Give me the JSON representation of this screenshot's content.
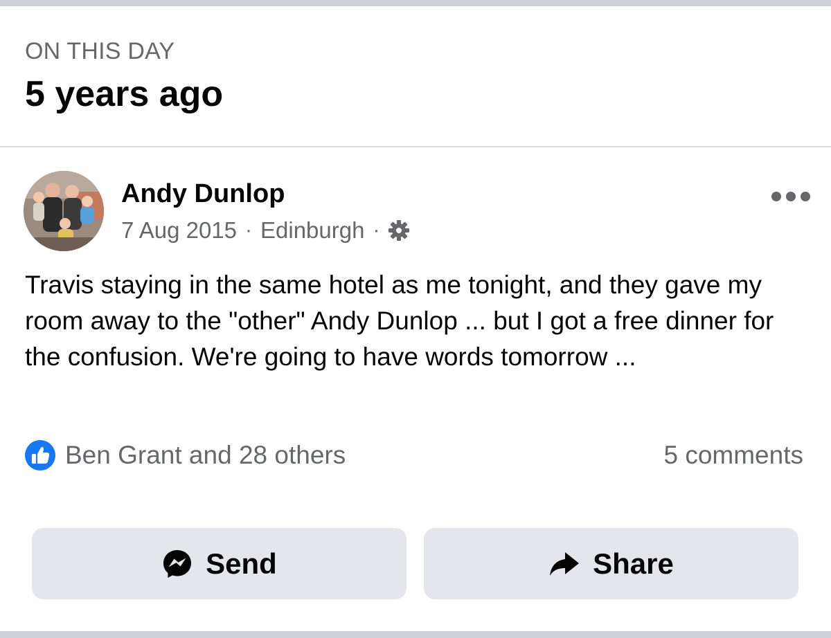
{
  "memory": {
    "kicker": "ON THIS DAY",
    "title": "5 years ago"
  },
  "post": {
    "author": "Andy Dunlop",
    "date": "7 Aug 2015",
    "location": "Edinburgh",
    "separator": "·",
    "privacy_icon": "gear-icon",
    "text": "Travis staying in the same hotel as me tonight, and they gave my room away to the \"other\" Andy Dunlop ... but I got a free dinner for the confusion. We're going to have words tomorrow ...",
    "reactions": {
      "icon": "like-icon",
      "text": "Ben Grant and 28 others"
    },
    "comments": "5 comments"
  },
  "actions": {
    "send_label": "Send",
    "send_icon": "messenger-icon",
    "share_label": "Share",
    "share_icon": "share-arrow-icon"
  },
  "colors": {
    "accent_blue": "#1877f2",
    "secondary_text": "#65676b",
    "button_bg": "#e4e6eb",
    "divider": "#dadde1"
  }
}
